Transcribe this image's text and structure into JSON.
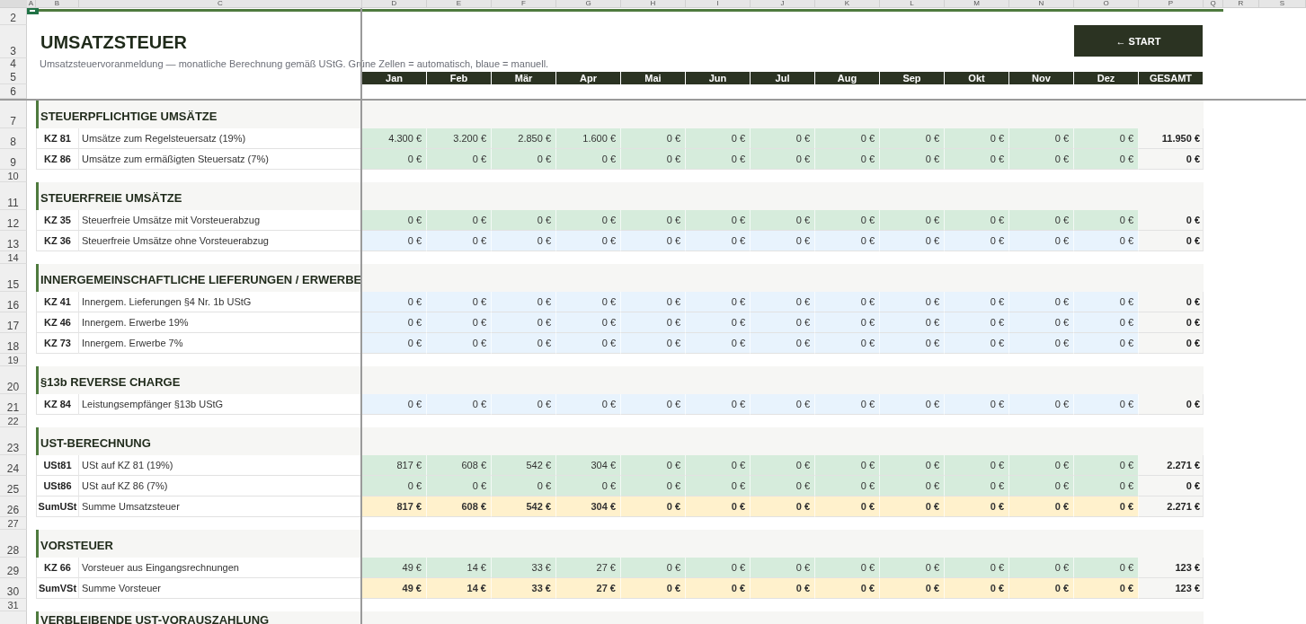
{
  "column_headers": [
    "A",
    "B",
    "C",
    "D",
    "E",
    "F",
    "G",
    "H",
    "I",
    "J",
    "K",
    "L",
    "M",
    "N",
    "O",
    "P",
    "Q",
    "R",
    "S"
  ],
  "header_row_numbers": [
    "2",
    "3",
    "4",
    "5",
    "6"
  ],
  "title": "UMSATZSTEUER",
  "subtitle": "Umsatzsteuervoranmeldung — monatliche Berechnung gemäß UStG. Grüne Zellen = automatisch, blaue = manuell.",
  "start_button": "← START",
  "months": [
    "Jan",
    "Feb",
    "Mär",
    "Apr",
    "Mai",
    "Jun",
    "Jul",
    "Aug",
    "Sep",
    "Okt",
    "Nov",
    "Dez",
    "GESAMT"
  ],
  "sections": [
    {
      "row_number": "7",
      "title": "STEUERPFLICHTIGE UMSÄTZE",
      "spacer_row_number": "10",
      "rows": [
        {
          "row_number": "8",
          "code": "KZ 81",
          "label": "Umsätze zum Regelsteuersatz (19%)",
          "kind": "auto",
          "values": [
            "4.300 €",
            "3.200 €",
            "2.850 €",
            "1.600 €",
            "0 €",
            "0 €",
            "0 €",
            "0 €",
            "0 €",
            "0 €",
            "0 €",
            "0 €"
          ],
          "total": "11.950 €"
        },
        {
          "row_number": "9",
          "code": "KZ 86",
          "label": "Umsätze zum ermäßigten Steuersatz (7%)",
          "kind": "auto",
          "values": [
            "0 €",
            "0 €",
            "0 €",
            "0 €",
            "0 €",
            "0 €",
            "0 €",
            "0 €",
            "0 €",
            "0 €",
            "0 €",
            "0 €"
          ],
          "total": "0 €"
        }
      ]
    },
    {
      "row_number": "11",
      "title": "STEUERFREIE UMSÄTZE",
      "spacer_row_number": "14",
      "rows": [
        {
          "row_number": "12",
          "code": "KZ 35",
          "label": "Steuerfreie Umsätze mit Vorsteuerabzug",
          "kind": "auto",
          "values": [
            "0 €",
            "0 €",
            "0 €",
            "0 €",
            "0 €",
            "0 €",
            "0 €",
            "0 €",
            "0 €",
            "0 €",
            "0 €",
            "0 €"
          ],
          "total": "0 €"
        },
        {
          "row_number": "13",
          "code": "KZ 36",
          "label": "Steuerfreie Umsätze ohne Vorsteuerabzug",
          "kind": "manual",
          "values": [
            "0 €",
            "0 €",
            "0 €",
            "0 €",
            "0 €",
            "0 €",
            "0 €",
            "0 €",
            "0 €",
            "0 €",
            "0 €",
            "0 €"
          ],
          "total": "0 €"
        }
      ]
    },
    {
      "row_number": "15",
      "title": "INNERGEMEINSCHAFTLICHE LIEFERUNGEN / ERWERBE",
      "spacer_row_number": "19",
      "rows": [
        {
          "row_number": "16",
          "code": "KZ 41",
          "label": "Innergem. Lieferungen §4 Nr. 1b UStG",
          "kind": "manual",
          "values": [
            "0 €",
            "0 €",
            "0 €",
            "0 €",
            "0 €",
            "0 €",
            "0 €",
            "0 €",
            "0 €",
            "0 €",
            "0 €",
            "0 €"
          ],
          "total": "0 €"
        },
        {
          "row_number": "17",
          "code": "KZ 46",
          "label": "Innergem. Erwerbe 19%",
          "kind": "manual",
          "values": [
            "0 €",
            "0 €",
            "0 €",
            "0 €",
            "0 €",
            "0 €",
            "0 €",
            "0 €",
            "0 €",
            "0 €",
            "0 €",
            "0 €"
          ],
          "total": "0 €"
        },
        {
          "row_number": "18",
          "code": "KZ 73",
          "label": "Innergem. Erwerbe 7%",
          "kind": "manual",
          "values": [
            "0 €",
            "0 €",
            "0 €",
            "0 €",
            "0 €",
            "0 €",
            "0 €",
            "0 €",
            "0 €",
            "0 €",
            "0 €",
            "0 €"
          ],
          "total": "0 €"
        }
      ]
    },
    {
      "row_number": "20",
      "title": "§13b REVERSE CHARGE",
      "spacer_row_number": "22",
      "rows": [
        {
          "row_number": "21",
          "code": "KZ 84",
          "label": "Leistungsempfänger §13b UStG",
          "kind": "manual",
          "values": [
            "0 €",
            "0 €",
            "0 €",
            "0 €",
            "0 €",
            "0 €",
            "0 €",
            "0 €",
            "0 €",
            "0 €",
            "0 €",
            "0 €"
          ],
          "total": "0 €"
        }
      ]
    },
    {
      "row_number": "23",
      "title": "UST-BERECHNUNG",
      "spacer_row_number": "27",
      "rows": [
        {
          "row_number": "24",
          "code": "USt81",
          "label": "USt auf KZ 81 (19%)",
          "kind": "auto",
          "values": [
            "817 €",
            "608 €",
            "542 €",
            "304 €",
            "0 €",
            "0 €",
            "0 €",
            "0 €",
            "0 €",
            "0 €",
            "0 €",
            "0 €"
          ],
          "total": "2.271 €"
        },
        {
          "row_number": "25",
          "code": "USt86",
          "label": "USt auf KZ 86 (7%)",
          "kind": "auto",
          "values": [
            "0 €",
            "0 €",
            "0 €",
            "0 €",
            "0 €",
            "0 €",
            "0 €",
            "0 €",
            "0 €",
            "0 €",
            "0 €",
            "0 €"
          ],
          "total": "0 €"
        },
        {
          "row_number": "26",
          "code": "SumUSt",
          "label": "Summe Umsatzsteuer",
          "kind": "sum",
          "values": [
            "817 €",
            "608 €",
            "542 €",
            "304 €",
            "0 €",
            "0 €",
            "0 €",
            "0 €",
            "0 €",
            "0 €",
            "0 €",
            "0 €"
          ],
          "total": "2.271 €"
        }
      ]
    },
    {
      "row_number": "28",
      "title": "VORSTEUER",
      "spacer_row_number": "31",
      "rows": [
        {
          "row_number": "29",
          "code": "KZ 66",
          "label": "Vorsteuer aus Eingangsrechnungen",
          "kind": "auto",
          "values": [
            "49 €",
            "14 €",
            "33 €",
            "27 €",
            "0 €",
            "0 €",
            "0 €",
            "0 €",
            "0 €",
            "0 €",
            "0 €",
            "0 €"
          ],
          "total": "123 €"
        },
        {
          "row_number": "30",
          "code": "SumVSt",
          "label": "Summe Vorsteuer",
          "kind": "sum",
          "values": [
            "49 €",
            "14 €",
            "33 €",
            "27 €",
            "0 €",
            "0 €",
            "0 €",
            "0 €",
            "0 €",
            "0 €",
            "0 €",
            "0 €"
          ],
          "total": "123 €"
        }
      ]
    },
    {
      "title": "VERBLEIBENDE UST-VORAUSZAHLUNG"
    }
  ]
}
